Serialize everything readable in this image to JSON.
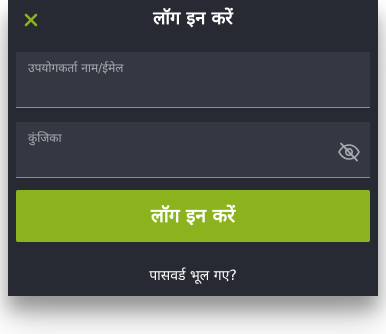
{
  "header": {
    "title": "लॉग इन करें",
    "close_icon": "close-icon"
  },
  "form": {
    "username": {
      "label": "उपयोगकर्ता नाम/ईमेल",
      "value": ""
    },
    "password": {
      "label": "कुंजिका",
      "value": "",
      "toggle_icon": "eye-slash-icon"
    },
    "submit_label": "लॉग इन करें",
    "forgot_label": "पासवर्ड भूल गए?"
  },
  "colors": {
    "accent": "#8bb31d",
    "background": "#272a33",
    "field": "#353842"
  }
}
